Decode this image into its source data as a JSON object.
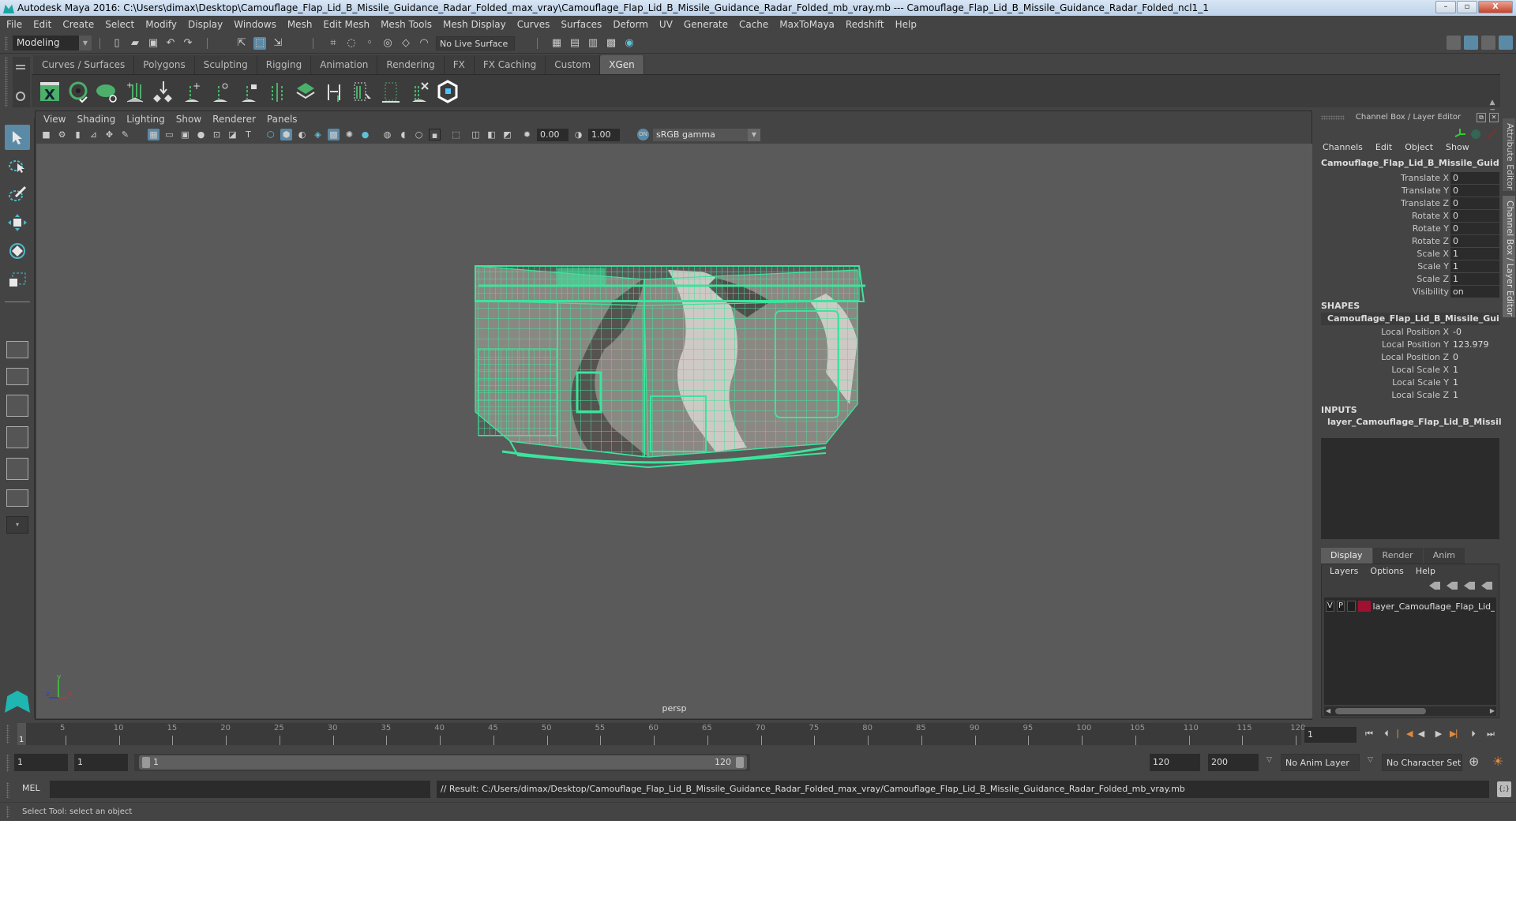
{
  "window": {
    "title": "Autodesk Maya 2016: C:\\Users\\dimax\\Desktop\\Camouflage_Flap_Lid_B_Missile_Guidance_Radar_Folded_max_vray\\Camouflage_Flap_Lid_B_Missile_Guidance_Radar_Folded_mb_vray.mb   ---   Camouflage_Flap_Lid_B_Missile_Guidance_Radar_Folded_ncl1_1",
    "minimize": "–",
    "maximize": "▫",
    "close": "X"
  },
  "menubar": [
    "File",
    "Edit",
    "Create",
    "Select",
    "Modify",
    "Display",
    "Windows",
    "Mesh",
    "Edit Mesh",
    "Mesh Tools",
    "Mesh Display",
    "Curves",
    "Surfaces",
    "Deform",
    "UV",
    "Generate",
    "Cache",
    "MaxToMaya",
    "Redshift",
    "Help"
  ],
  "statusline": {
    "mode": "Modeling",
    "live_surface": "No Live Surface"
  },
  "shelf": {
    "tabs": [
      "Curves / Surfaces",
      "Polygons",
      "Sculpting",
      "Rigging",
      "Animation",
      "Rendering",
      "FX",
      "FX Caching",
      "Custom",
      "XGen"
    ],
    "active_tab": "XGen",
    "icons": [
      "xgen-library-icon",
      "xgen-preview-icon",
      "xgen-hide-icon",
      "xgen-add-guides-icon",
      "xgen-place-icon",
      "xgen-add-guide-icon",
      "xgen-show-guide-icon",
      "xgen-lock-guide-icon",
      "xgen-split-icon",
      "xgen-layers-icon",
      "xgen-interactive-grooming-icon",
      "xgen-select-icon",
      "xgen-rebuild-icon",
      "xgen-delete-icon",
      "xgen-app-icon"
    ]
  },
  "viewport": {
    "menu": [
      "View",
      "Shading",
      "Lighting",
      "Show",
      "Renderer",
      "Panels"
    ],
    "exposure": "0.00",
    "gamma": "1.00",
    "color_space": "sRGB gamma",
    "camera_label": "persp",
    "axis": {
      "x": "x",
      "y": "y",
      "z": "z"
    },
    "wireframe_color": "#3de39c"
  },
  "channel_box": {
    "header": "Channel Box / Layer Editor",
    "menu": [
      "Channels",
      "Edit",
      "Object",
      "Show"
    ],
    "object_name": "Camouflage_Flap_Lid_B_Missile_Guidan...",
    "attributes": [
      {
        "label": "Translate X",
        "value": "0"
      },
      {
        "label": "Translate Y",
        "value": "0"
      },
      {
        "label": "Translate Z",
        "value": "0"
      },
      {
        "label": "Rotate X",
        "value": "0"
      },
      {
        "label": "Rotate Y",
        "value": "0"
      },
      {
        "label": "Rotate Z",
        "value": "0"
      },
      {
        "label": "Scale X",
        "value": "1"
      },
      {
        "label": "Scale Y",
        "value": "1"
      },
      {
        "label": "Scale Z",
        "value": "1"
      },
      {
        "label": "Visibility",
        "value": "on"
      }
    ],
    "shapes_title": "SHAPES",
    "shape_name": "Camouflage_Flap_Lid_B_Missile_Guida...",
    "shape_attributes": [
      {
        "label": "Local Position X",
        "value": "-0"
      },
      {
        "label": "Local Position Y",
        "value": "123.979"
      },
      {
        "label": "Local Position Z",
        "value": "0"
      },
      {
        "label": "Local Scale X",
        "value": "1"
      },
      {
        "label": "Local Scale Y",
        "value": "1"
      },
      {
        "label": "Local Scale Z",
        "value": "1"
      }
    ],
    "inputs_title": "INPUTS",
    "input_name": "layer_Camouflage_Flap_Lid_B_Missile_..."
  },
  "side_tabs": [
    "Attribute Editor",
    "Channel Box / Layer Editor"
  ],
  "layer_editor": {
    "tabs": [
      "Display",
      "Render",
      "Anim"
    ],
    "active_tab": "Display",
    "menu": [
      "Layers",
      "Options",
      "Help"
    ],
    "layers": [
      {
        "visible": "V",
        "playback": "P",
        "name": "layer_Camouflage_Flap_Lid_B_Missile_Guidance_Radar_Folded",
        "color": "#a01030"
      }
    ]
  },
  "timeline": {
    "ticks": [
      5,
      10,
      15,
      20,
      25,
      30,
      35,
      40,
      45,
      50,
      55,
      60,
      65,
      70,
      75,
      80,
      85,
      90,
      95,
      100,
      105,
      110,
      115,
      120
    ],
    "start": 1,
    "end": 120,
    "current_frame_marker": "1",
    "current_frame": "1"
  },
  "range": {
    "start_time": "1",
    "playback_start": "1",
    "range_start_label": "1",
    "range_end_label": "120",
    "playback_end": "120",
    "end_time": "200",
    "anim_layer": "No Anim Layer",
    "character_set": "No Character Set"
  },
  "command_line": {
    "label": "MEL",
    "input": "",
    "result": "// Result: C:/Users/dimax/Desktop/Camouflage_Flap_Lid_B_Missile_Guidance_Radar_Folded_max_vray/Camouflage_Flap_Lid_B_Missile_Guidance_Radar_Folded_mb_vray.mb"
  },
  "help_line": "Select Tool: select an object"
}
